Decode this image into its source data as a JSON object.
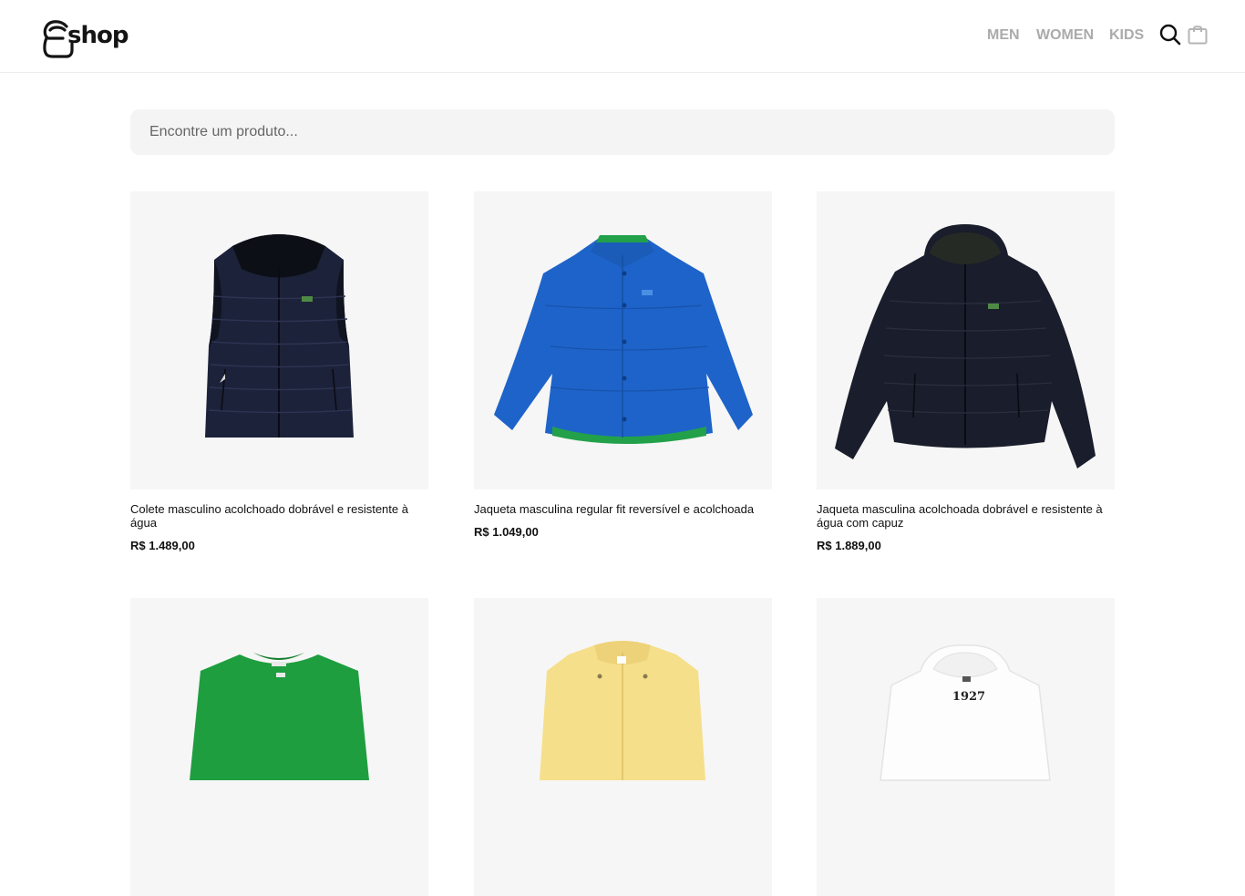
{
  "header": {
    "logo_text": "shop",
    "nav": [
      {
        "label": "MEN"
      },
      {
        "label": "WOMEN"
      },
      {
        "label": "KIDS"
      }
    ],
    "icons": [
      "search-icon",
      "shopping-bag-icon"
    ]
  },
  "search": {
    "placeholder": "Encontre um produto...",
    "value": ""
  },
  "products": [
    {
      "title": "Colete masculino acolchoado dobrável e resistente à água",
      "price": "R$ 1.489,00",
      "image": "navy-quilted-vest"
    },
    {
      "title": "Jaqueta masculina regular fit reversível e acolchoada",
      "price": "R$ 1.049,00",
      "image": "blue-padded-jacket"
    },
    {
      "title": "Jaqueta masculina acolchoada dobrável e resistente à água com capuz",
      "price": "R$ 1.889,00",
      "image": "navy-hooded-puffer-jacket"
    },
    {
      "title": "",
      "price": "",
      "image": "green-tshirt"
    },
    {
      "title": "",
      "price": "",
      "image": "yellow-jacket"
    },
    {
      "title": "",
      "price": "",
      "image": "white-hoodie"
    }
  ],
  "colors": {
    "nav_text": "#ababab",
    "search_bg": "#f4f4f4",
    "card_bg": "#f6f6f6"
  },
  "image_text": {
    "hoodie_print": "1927"
  }
}
